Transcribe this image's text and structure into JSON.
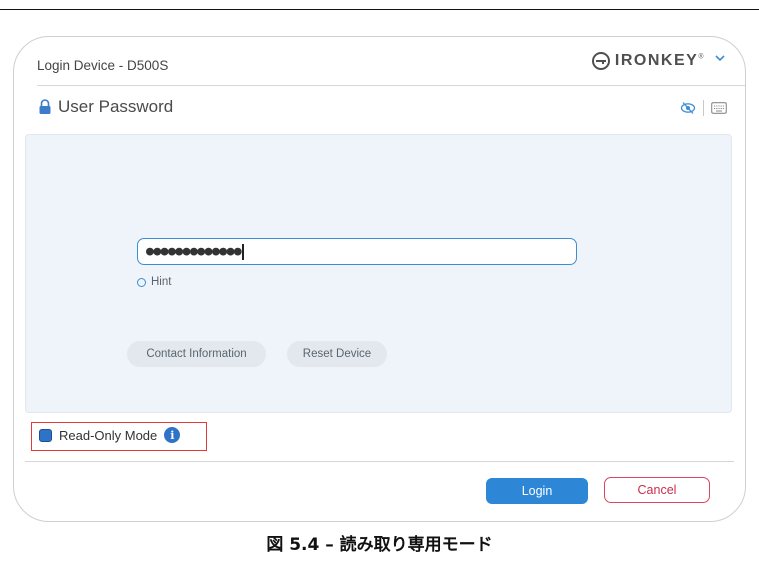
{
  "window": {
    "title": "Login Device - D500S",
    "brand": {
      "name": "IRONKEY",
      "reg_mark": "®",
      "color": "#4f4f4f"
    }
  },
  "section": {
    "title": "User Password",
    "icon": "lock-icon"
  },
  "view_icons": [
    "eye-slash-icon",
    "keyboard-icon"
  ],
  "password": {
    "masked_value": "●●●●●●●●●●●●●"
  },
  "hint": {
    "label": "Hint"
  },
  "buttons": {
    "contact": "Contact Information",
    "reset": "Reset Device",
    "login": "Login",
    "cancel": "Cancel"
  },
  "read_only": {
    "label": "Read-Only Mode",
    "checked": true,
    "info_icon": "i"
  },
  "caption": "図 5.4 – 読み取り専用モード",
  "colors": {
    "accent": "#2e86d6",
    "cancel": "#d9475e",
    "highlight_box": "#e03a3a",
    "panel": "#eff4fa"
  }
}
